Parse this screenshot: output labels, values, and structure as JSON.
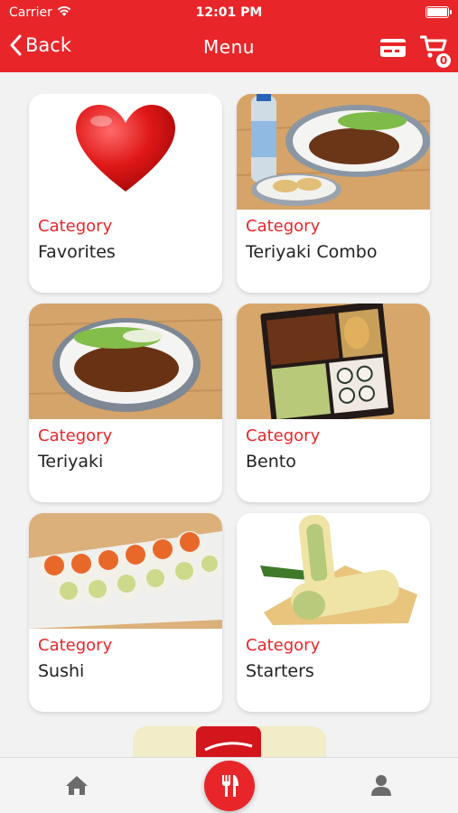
{
  "status_bar": {
    "carrier": "Carrier",
    "time": "12:01 PM"
  },
  "nav": {
    "back_label": "Back",
    "title": "Menu",
    "cart_count": "0"
  },
  "categories": [
    {
      "label": "Category",
      "name": "Favorites"
    },
    {
      "label": "Category",
      "name": "Teriyaki Combo"
    },
    {
      "label": "Category",
      "name": "Teriyaki"
    },
    {
      "label": "Category",
      "name": "Bento"
    },
    {
      "label": "Category",
      "name": "Sushi"
    },
    {
      "label": "Category",
      "name": "Starters"
    }
  ],
  "tabs": [
    {
      "icon": "home-icon"
    },
    {
      "icon": "fork-knife-icon"
    },
    {
      "icon": "person-icon"
    }
  ],
  "colors": {
    "accent": "#e8262a",
    "background": "#f2f2f2"
  }
}
